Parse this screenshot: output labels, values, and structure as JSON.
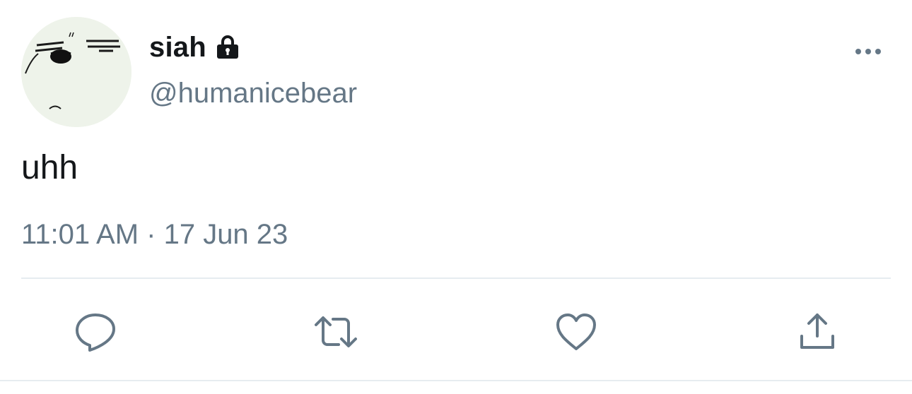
{
  "tweet": {
    "display_name": "siah",
    "handle": "@humanicebear",
    "protected": true,
    "text": "uhh",
    "timestamp": "11:01 AM · 17 Jun 23"
  },
  "icons": {
    "lock": "lock-icon",
    "more": "more-options-icon",
    "reply": "reply-icon",
    "retweet": "retweet-icon",
    "like": "heart-icon",
    "share": "share-icon"
  },
  "colors": {
    "text_primary": "#14171a",
    "text_secondary": "#657786",
    "icon": "#657786",
    "divider": "#e6ecf0",
    "avatar_bg": "#eef3ea"
  }
}
